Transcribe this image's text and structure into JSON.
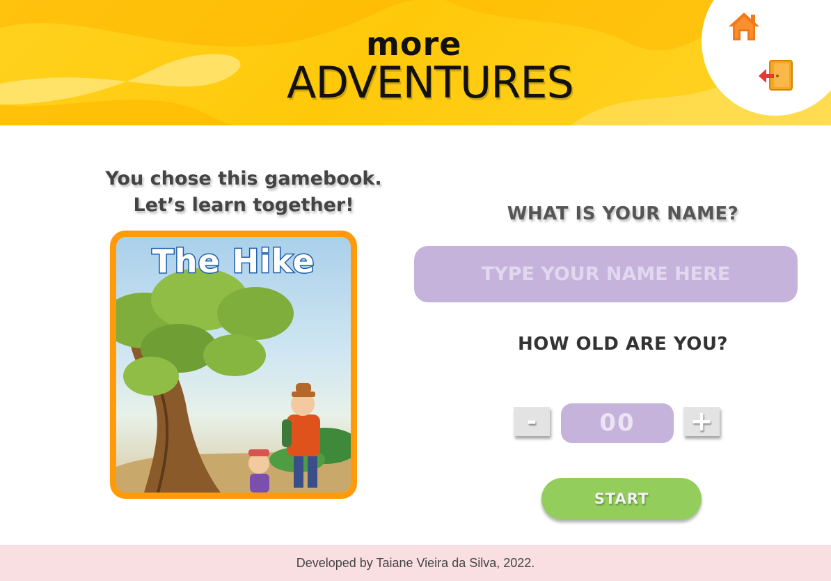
{
  "header": {
    "logo_top": "more",
    "logo_main": "ADVENTURES",
    "logo_mark": "©",
    "home_icon": "home-icon",
    "exit_icon": "exit-door-icon"
  },
  "intro": {
    "line1": "You chose this gamebook.",
    "line2": "Let’s learn together!"
  },
  "book": {
    "title": "The Hike"
  },
  "form": {
    "name_question": "WHAT IS YOUR NAME?",
    "name_placeholder": "TYPE YOUR NAME HERE",
    "age_question": "HOW OLD ARE YOU?",
    "minus_label": "-",
    "plus_label": "+",
    "age_value": "00",
    "start_label": "START"
  },
  "footer": {
    "credit": "Developed by Taiane Vieira da Silva, 2022."
  },
  "colors": {
    "header_yellow": "#ffd21f",
    "book_border": "#ff9a0a",
    "input_purple": "#c5b3dc",
    "start_green": "#93cd5b",
    "footer_pink": "#f9dfe2",
    "icon_orange": "#f07a1a"
  }
}
